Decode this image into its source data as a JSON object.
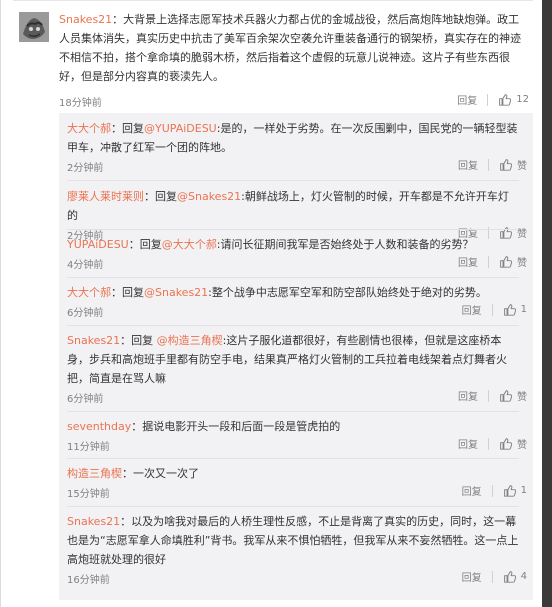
{
  "main_comment": {
    "user": "Snakes21",
    "sep": "：",
    "text": "大背景上选择志愿军技术兵器火力都占优的金城战役，然后高炮阵地缺炮弹。政工人员集体消失，真实历史中抗击了美军百余架次空袭允许重装备通行的钢架桥，真实存在的神迹不相信不拍，搭个拿命填的脆弱木桥，然后指着这个虚假的玩意儿说神迹。这片子有些东西很好，但是部分内容真的亵渎先人。",
    "time": "18分钟前",
    "reply_label": "回复",
    "likes": "12"
  },
  "replies": [
    {
      "user": "大大个郝",
      "prefix": "：回复",
      "mention": "@YUPAiDESU",
      "text": ":是的，一样处于劣势。在一次反围剿中，国民党的一辆轻型装甲车，冲散了红军一个团的阵地。",
      "time": "2分钟前",
      "reply_label": "回复",
      "likes": "赞"
    },
    {
      "user": "廖莱人莱时莱则",
      "prefix": "：回复",
      "mention": "@Snakes21",
      "text": ":朝鲜战场上，灯火管制的时候，开车都是不允许开车灯的",
      "time": "2分钟前",
      "reply_label": "回复",
      "likes": "赞"
    },
    {
      "user": "YUPAiDESU",
      "prefix": "：回复",
      "mention": "@大大个郝",
      "text": ":请问长征期间我军是否始终处于人数和装备的劣势？",
      "time": "4分钟前",
      "reply_label": "回复",
      "likes": "赞"
    },
    {
      "user": "大大个郝",
      "prefix": "：回复",
      "mention": "@Snakes21",
      "text": ":整个战争中志愿军空军和防空部队始终处于绝对的劣势。",
      "time": "6分钟前",
      "reply_label": "回复",
      "likes": "1"
    },
    {
      "user": "Snakes21",
      "prefix": "：回复 ",
      "mention": "@构造三角楔",
      "text": ":这片子服化道都很好，有些剧情也很棒，但就是这座桥本身，步兵和高炮班手里都有防空手电，结果真严格灯火管制的工兵拉着电线架着点灯舞者火把，简直是在骂人嘛",
      "time": "6分钟前",
      "reply_label": "回复",
      "likes": "赞"
    },
    {
      "user": "seventhday",
      "prefix": "：",
      "mention": "",
      "text": "据说电影开头一段和后面一段是管虎拍的",
      "time": "11分钟前",
      "reply_label": "回复",
      "likes": "赞"
    },
    {
      "user": "构造三角楔",
      "prefix": "：",
      "mention": "",
      "text": "一次又一次了",
      "time": "15分钟前",
      "reply_label": "回复",
      "likes": "1"
    },
    {
      "user": "Snakes21",
      "prefix": "：",
      "mention": "",
      "text": "以及为啥我对最后的人桥生理性反感，不止是背离了真实的历史，同时，这一幕也是为“志愿军拿人命填胜利”背书。我军从来不惧怕牺牲，但我军从来不妄然牺牲。这一点上高炮班就处理的很好",
      "time": "16分钟前",
      "reply_label": "回复",
      "likes": "4"
    }
  ],
  "colors": {
    "username": "#eb7350",
    "meta": "#808080",
    "reply_bg": "#f2f2f5"
  }
}
